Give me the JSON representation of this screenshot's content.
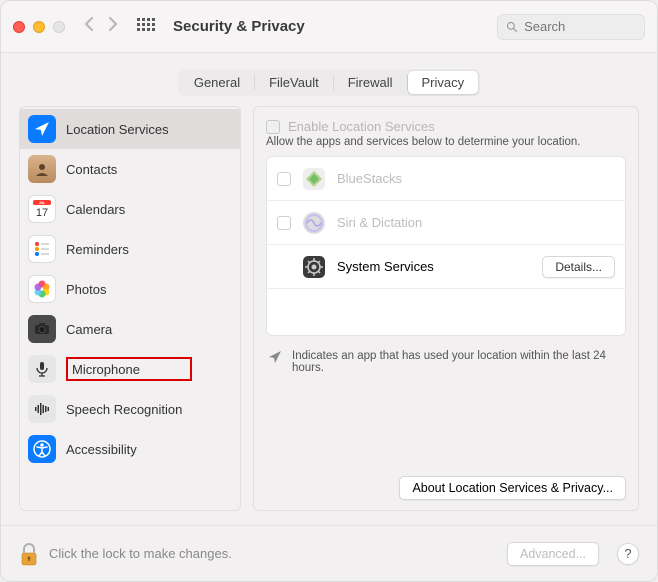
{
  "title": "Security & Privacy",
  "search": {
    "placeholder": "Search"
  },
  "tabs": [
    "General",
    "FileVault",
    "Firewall",
    "Privacy"
  ],
  "active_tab": 3,
  "sidebar": {
    "selected": 0,
    "highlighted": 6,
    "items": [
      {
        "label": "Location Services",
        "icon": "location-arrow"
      },
      {
        "label": "Contacts",
        "icon": "contacts"
      },
      {
        "label": "Calendars",
        "icon": "calendar"
      },
      {
        "label": "Reminders",
        "icon": "reminders"
      },
      {
        "label": "Photos",
        "icon": "photos"
      },
      {
        "label": "Camera",
        "icon": "camera"
      },
      {
        "label": "Microphone",
        "icon": "microphone"
      },
      {
        "label": "Speech Recognition",
        "icon": "speech"
      },
      {
        "label": "Accessibility",
        "icon": "accessibility"
      }
    ]
  },
  "panel": {
    "enable_label": "Enable Location Services",
    "subtext": "Allow the apps and services below to determine your location.",
    "apps": [
      {
        "name": "BlueStacks",
        "checkbox": true,
        "checked": false,
        "disabled": true,
        "icon": "bluestacks"
      },
      {
        "name": "Siri & Dictation",
        "checkbox": true,
        "checked": false,
        "disabled": true,
        "icon": "siri"
      },
      {
        "name": "System Services",
        "checkbox": false,
        "disabled": false,
        "icon": "gear",
        "button": "Details..."
      }
    ],
    "indicator_text": "Indicates an app that has used your location within the last 24 hours.",
    "about_button": "About Location Services & Privacy..."
  },
  "bottom": {
    "lock_text": "Click the lock to make changes.",
    "advanced": "Advanced...",
    "help": "?"
  }
}
